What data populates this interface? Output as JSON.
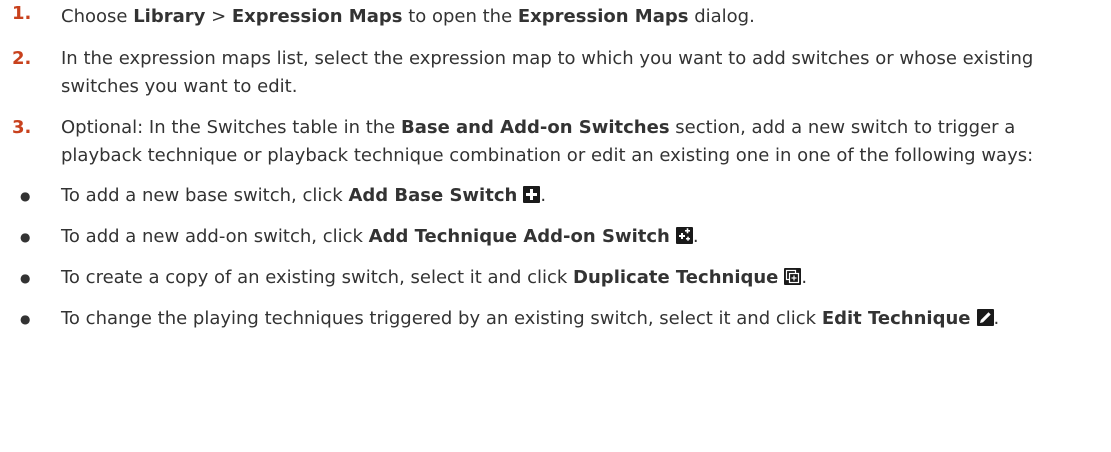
{
  "steps": [
    {
      "num": "1.",
      "p1": "Choose ",
      "b1": "Library",
      "p2": " > ",
      "b2": "Expression Maps",
      "p3": " to open the ",
      "b3": "Expression Maps",
      "p4": " dialog."
    },
    {
      "num": "2.",
      "text": "In the expression maps list, select the expression map to which you want to add switches or whose existing switches you want to edit."
    },
    {
      "num": "3.",
      "p1": "Optional: In the Switches table in the ",
      "b1": "Base and Add-on Switches",
      "p2": " section, add a new switch to trigger a playback technique or playback technique combination or edit an existing one in one of the following ways:"
    }
  ],
  "bullets": [
    {
      "dot": "●",
      "text": "To add a new base switch, click ",
      "bold": "Add Base Switch",
      "icon": "plus-icon",
      "end": "."
    },
    {
      "dot": "●",
      "text": "To add a new add-on switch, click ",
      "bold": "Add Technique Add-on Switch",
      "icon": "add-on-switch-icon",
      "end": "."
    },
    {
      "dot": "●",
      "text": "To create a copy of an existing switch, select it and click ",
      "bold": "Duplicate Technique",
      "icon": "duplicate-icon",
      "end": "."
    },
    {
      "dot": "●",
      "text": "To change the playing techniques triggered by an existing switch, select it and click ",
      "bold": "Edit Technique",
      "icon": "pencil-icon",
      "end": "."
    }
  ],
  "colors": {
    "step_number": "#c8411d",
    "text": "#333333",
    "icon_bg": "#1a1a1a"
  }
}
